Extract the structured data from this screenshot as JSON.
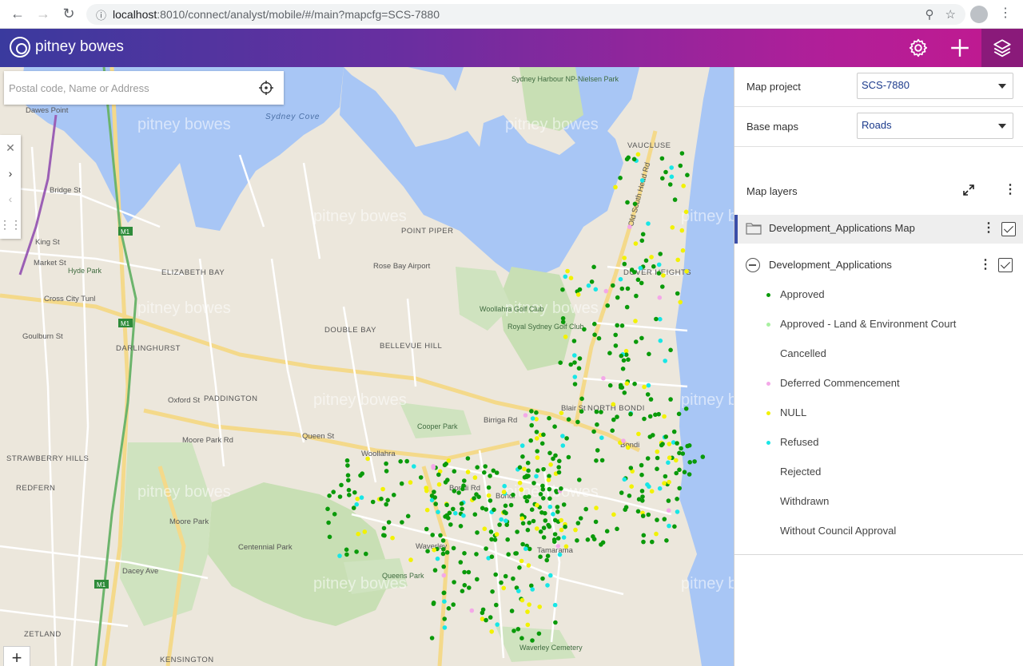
{
  "browser": {
    "url_host": "localhost",
    "url_path": ":8010/connect/analyst/mobile/#/main?mapcfg=SCS-7880"
  },
  "header": {
    "logo_text": "pitney bowes",
    "buttons": [
      "settings-gear-icon",
      "add-plus-icon",
      "layers-icon"
    ]
  },
  "search": {
    "placeholder": "Postal code, Name or Address"
  },
  "map": {
    "watermark": "pitney bowes",
    "labels": {
      "dawes_point": "Dawes Point",
      "sydney_cove": "Sydney Cove",
      "bridge_st": "Bridge St",
      "king_st": "King St",
      "market_st": "Market St",
      "hyde_park": "Hyde Park",
      "elizabeth_bay": "ELIZABETH BAY",
      "cross_city_tunl": "Cross City Tunl",
      "goulburn_st": "Goulburn St",
      "darlinghurst": "DARLINGHURST",
      "paddington": "PADDINGTON",
      "oxford_st": "Oxford St",
      "moore_park_rd": "Moore Park Rd",
      "strawberry_hills": "STRAWBERRY HILLS",
      "redfern": "REDFERN",
      "moore_park": "Moore Park",
      "centennial_park": "Centennial Park",
      "dacey_ave": "Dacey Ave",
      "zetland": "ZETLAND",
      "kensington": "KENSINGTON",
      "double_bay": "DOUBLE BAY",
      "bellevue_hill": "BELLEVUE HILL",
      "point_piper": "POINT PIPER",
      "rose_bay_airport": "Rose Bay Airport",
      "woollahra": "Woollahra",
      "queens_park": "Queens Park",
      "waverley": "Waverley",
      "bondi": "Bondi",
      "bondi_2": "Bondi",
      "north_bondi": "NORTH BONDI",
      "dover_heights": "DOVER HEIGHTS",
      "vaucluse": "VAUCLUSE",
      "tamarama": "Tamarama",
      "waverley_cemetery": "Waverley Cemetery",
      "royal_sydney_golf_club": "Royal Sydney Golf Club",
      "woollahra_golf_club": "Woollahra Golf Club",
      "sydney_harbour_np": "Sydney Harbour NP-Nielsen Park",
      "cooper_park": "Cooper Park",
      "old_south_head_rd": "Old South Head Rd",
      "queen_st": "Queen St",
      "bondi_rd": "Bondi Rd",
      "birriga_rd": "Birriga Rd",
      "blair_st": "Blair St",
      "m1": "M1"
    }
  },
  "panel": {
    "map_project_label": "Map project",
    "map_project_value": "SCS-7880",
    "base_maps_label": "Base maps",
    "base_maps_value": "Roads",
    "map_layers_title": "Map layers",
    "layer_group": "Development_Applications Map",
    "layer": "Development_Applications",
    "legend": [
      {
        "label": "Approved",
        "color": "#0a9a0a"
      },
      {
        "label": "Approved - Land & Environment Court",
        "color": "#a8f0a0"
      },
      {
        "label": "Cancelled",
        "color": ""
      },
      {
        "label": "Deferred Commencement",
        "color": "#f4a8e8"
      },
      {
        "label": "NULL",
        "color": "#f2f200"
      },
      {
        "label": "Refused",
        "color": "#18e6e6"
      },
      {
        "label": "Rejected",
        "color": ""
      },
      {
        "label": "Withdrawn",
        "color": ""
      },
      {
        "label": "Without Council Approval",
        "color": ""
      }
    ]
  }
}
